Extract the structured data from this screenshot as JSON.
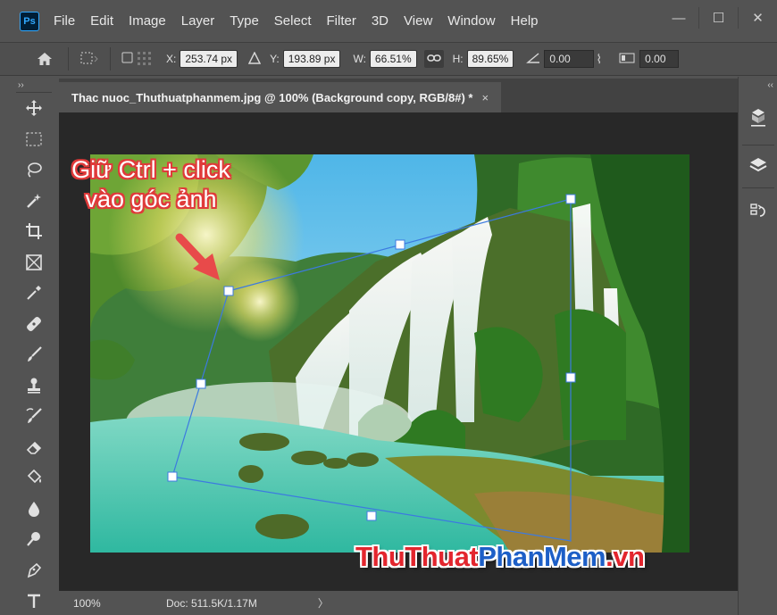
{
  "app": {
    "logo": "Ps"
  },
  "menu": [
    "File",
    "Edit",
    "Image",
    "Layer",
    "Type",
    "Select",
    "Filter",
    "3D",
    "View",
    "Window",
    "Help"
  ],
  "window_controls": {
    "minimize": "—",
    "restore": "☐",
    "close": "✕"
  },
  "options": {
    "x_label": "X:",
    "x_value": "253.74 px",
    "y_label": "Y:",
    "y_value": "193.89 px",
    "w_label": "W:",
    "w_value": "66.51%",
    "h_label": "H:",
    "h_value": "89.65%",
    "angle_value": "0.00",
    "skew_value": "0.00"
  },
  "document": {
    "tab_title": "Thac nuoc_Thuthuatphanmem.jpg @ 100% (Background copy, RGB/8#) *",
    "tab_close": "×"
  },
  "status": {
    "zoom": "100%",
    "doc": "Doc: 511.5K/1.17M",
    "arrow": "〉"
  },
  "panel": {
    "collapse_left": "››",
    "collapse_right": "‹‹"
  },
  "annotation": {
    "line1": "Giữ Ctrl + click",
    "line2": "vào góc ảnh"
  },
  "watermark": {
    "part1": "ThuThuat",
    "part2": "PhanMem",
    "part3": ".vn"
  },
  "colors": {
    "annotation_red": "#e03a3a",
    "watermark_red": "#e3262e",
    "watermark_blue": "#1d5fc7",
    "transform_line": "#3c7ae0",
    "ps_blue": "#31a8ff"
  }
}
